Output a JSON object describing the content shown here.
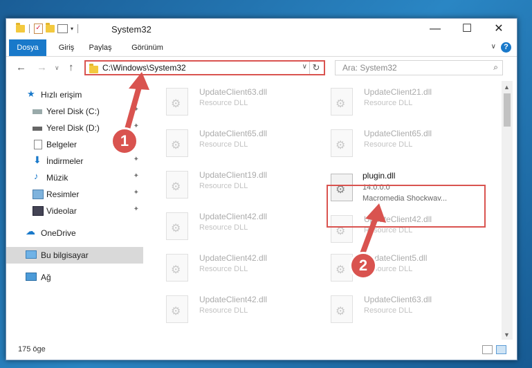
{
  "titlebar": {
    "title": "System32",
    "min": "—",
    "max": "☐",
    "close": "✕"
  },
  "ribbon": {
    "tabs": [
      "Dosya",
      "Giriş",
      "Paylaş",
      "Görünüm"
    ],
    "expand": "∨",
    "help": "?"
  },
  "nav": {
    "back": "←",
    "forward": "→",
    "dropdown": "∨",
    "up": "↑",
    "path": "C:\\Windows\\System32",
    "path_dd": "∨",
    "refresh": "↻",
    "search_placeholder": "Ara: System32",
    "search_icon": "⌕"
  },
  "sidebar": {
    "items": [
      {
        "label": "Hızlı erişim",
        "icon": "star-icon"
      },
      {
        "label": "Yerel Disk (C:)",
        "icon": "drive-icon",
        "pinned": true
      },
      {
        "label": "Yerel Disk (D:)",
        "icon": "drive-icon",
        "pinned": true
      },
      {
        "label": "Belgeler",
        "icon": "document-icon",
        "pinned": true
      },
      {
        "label": "İndirmeler",
        "icon": "download-icon",
        "pinned": true
      },
      {
        "label": "Müzik",
        "icon": "music-icon",
        "pinned": true
      },
      {
        "label": "Resimler",
        "icon": "pictures-icon",
        "pinned": true
      },
      {
        "label": "Videolar",
        "icon": "video-icon",
        "pinned": true
      },
      {
        "label": "OneDrive",
        "icon": "cloud-icon"
      },
      {
        "label": "Bu bilgisayar",
        "icon": "computer-icon",
        "selected": true
      },
      {
        "label": "Ağ",
        "icon": "network-icon"
      }
    ],
    "pin": "📌"
  },
  "files": [
    {
      "name": "UpdateClient63.dll",
      "type": "Resource DLL"
    },
    {
      "name": "UpdateClient21.dll",
      "type": "Resource DLL"
    },
    {
      "name": "UpdateClient65.dll",
      "type": "Resource DLL"
    },
    {
      "name": "UpdateClient65.dll",
      "type": "Resource DLL"
    },
    {
      "name": "UpdateClient19.dll",
      "type": "Resource DLL"
    },
    {
      "name": "plugin.dll",
      "type": "14.0.0.0",
      "desc": "Macromedia Shockwav..."
    },
    {
      "name": "UpdateClient42.dll",
      "type": "Resource DLL"
    },
    {
      "name": "UpdateClient42.dll",
      "type": "Resource DLL"
    },
    {
      "name": "UpdateClient42.dll",
      "type": "Resource DLL"
    },
    {
      "name": "UpdateClient5.dll",
      "type": "Resource DLL"
    },
    {
      "name": "UpdateClient42.dll",
      "type": "Resource DLL"
    },
    {
      "name": "UpdateClient63.dll",
      "type": "Resource DLL"
    }
  ],
  "status": {
    "count": "175 öge"
  },
  "callouts": {
    "one": "1",
    "two": "2"
  },
  "colors": {
    "accent": "#1979ca",
    "highlight": "#d9534f"
  }
}
